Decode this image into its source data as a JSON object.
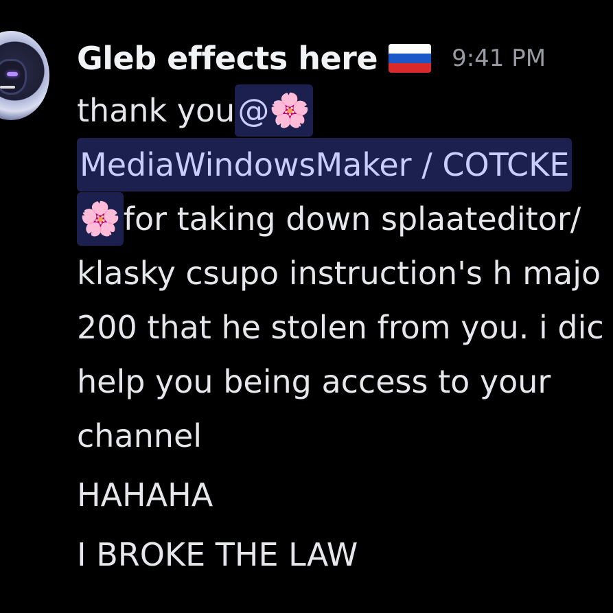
{
  "message": {
    "username": "Gleb effects here",
    "flag_icon": "russian-flag-icon",
    "timestamp": "9:41 PM",
    "avatar_icon": "character-avatar",
    "lines": {
      "l1_text": "thank you ",
      "mention_at": "@",
      "flower_emoji": "🌸",
      "mention_name": "MediaWindowsMaker / COTCKE",
      "l3_text": " for taking down splaateditor/",
      "l4_text": "klasky csupo instruction's h majo",
      "l5_text": "200 that he stolen from you. i dic",
      "l6_text": "help you being access to your",
      "l7_text": "channel",
      "l8_text": "HAHAHA",
      "l9_text": "I BROKE THE LAW"
    }
  },
  "colors": {
    "background": "#000000",
    "text": "#E6E7EA",
    "mention_bg": "#3C3F8C",
    "mention_text": "#C9CDFB",
    "timestamp": "#9A9CA3"
  }
}
